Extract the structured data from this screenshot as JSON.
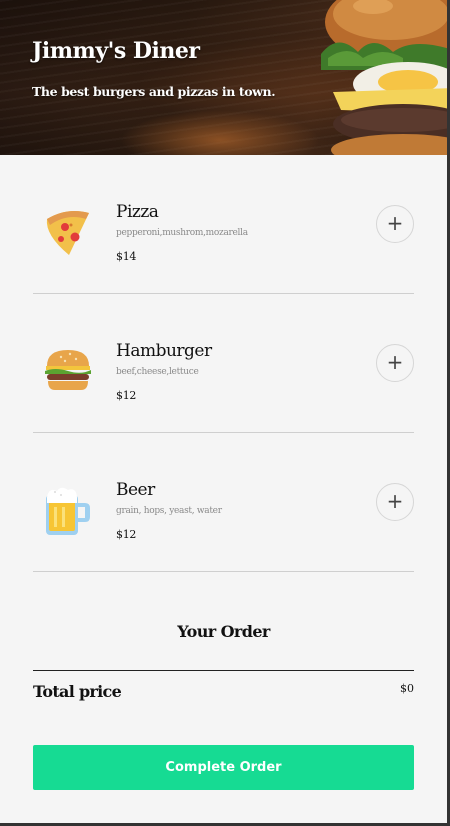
{
  "header": {
    "title": "Jimmy's Diner",
    "subtitle": "The best burgers and pizzas in town."
  },
  "menu": [
    {
      "name": "Pizza",
      "ingredients": "pepperoni,mushrom,mozarella",
      "price": "$14",
      "icon": "pizza-icon"
    },
    {
      "name": "Hamburger",
      "ingredients": "beef,cheese,lettuce",
      "price": "$12",
      "icon": "hamburger-icon"
    },
    {
      "name": "Beer",
      "ingredients": "grain, hops, yeast, water",
      "price": "$12",
      "icon": "beer-icon"
    }
  ],
  "add_symbol": "+",
  "order": {
    "title": "Your Order",
    "total_label": "Total price",
    "total_value": "$0"
  },
  "complete_button": "Complete Order",
  "colors": {
    "accent": "#16db93",
    "background": "#f5f5f5"
  }
}
